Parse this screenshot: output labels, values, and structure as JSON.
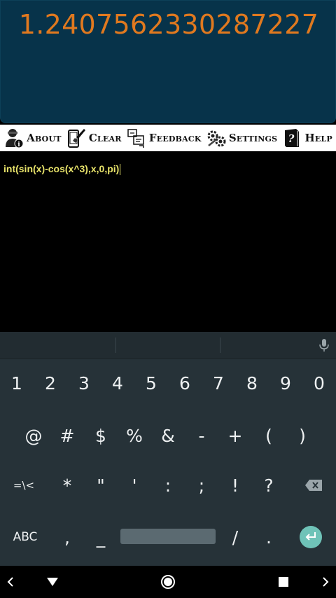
{
  "result": {
    "value": "1.2407562330287227"
  },
  "menu": {
    "items": [
      {
        "label": "About",
        "icon": "user-info-icon"
      },
      {
        "label": "Clear",
        "icon": "phone-brush-icon"
      },
      {
        "label": "Feedback",
        "icon": "feedback-icon"
      },
      {
        "label": "Settings",
        "icon": "gear-icon"
      },
      {
        "label": "Help",
        "icon": "help-book-icon"
      }
    ]
  },
  "input": {
    "expression": "int(sin(x)-cos(x^3),x,0,pi)"
  },
  "keyboard": {
    "row1": [
      "1",
      "2",
      "3",
      "4",
      "5",
      "6",
      "7",
      "8",
      "9",
      "0"
    ],
    "row2": [
      "@",
      "#",
      "$",
      "%",
      "&",
      "-",
      "+",
      "(",
      ")"
    ],
    "row3": [
      "=\\<",
      "*",
      "\"",
      "'",
      ":",
      ";",
      "!",
      "?"
    ],
    "row4": {
      "abc": "ABC",
      "comma": ",",
      "underscore": "_",
      "slash": "/",
      "period": "."
    }
  },
  "colors": {
    "result_bg": "#07334a",
    "result_text": "#e0791f",
    "expression_text": "#e8e36a",
    "keyboard_bg": "#263238",
    "enter_accent": "#6fc3b8"
  }
}
